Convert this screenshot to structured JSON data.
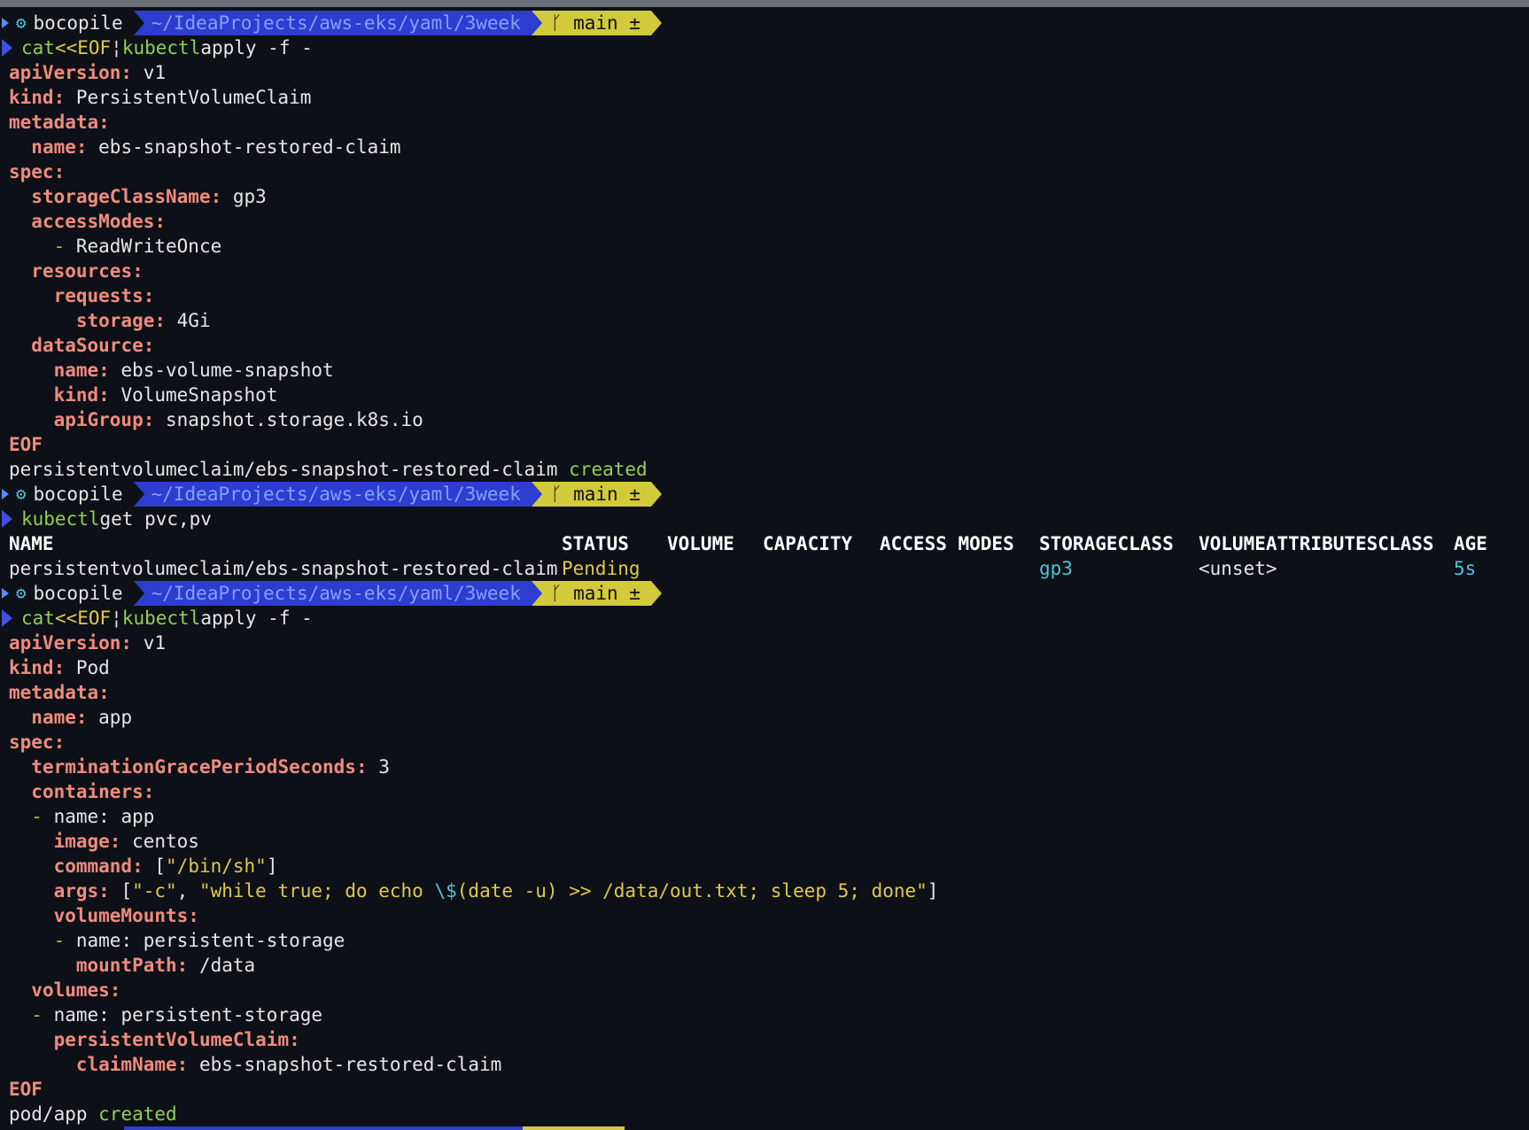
{
  "prompt": {
    "user": "bocopile",
    "path": "~/IdeaProjects/aws-eks/yaml/3week",
    "branch": "main ±"
  },
  "cmd1": {
    "a": "cat",
    "b": "<<EOF",
    "pipe": "¦",
    "c": "kubectl",
    "d": "apply -f -"
  },
  "yaml1": [
    {
      "indent": "",
      "key": "apiVersion:",
      "val": " v1"
    },
    {
      "indent": "",
      "key": "kind:",
      "val": " PersistentVolumeClaim"
    },
    {
      "indent": "",
      "key": "metadata:",
      "val": ""
    },
    {
      "indent": "  ",
      "key": "name:",
      "val": " ebs-snapshot-restored-claim"
    },
    {
      "indent": "",
      "key": "spec:",
      "val": ""
    },
    {
      "indent": "  ",
      "key": "storageClassName:",
      "val": " gp3"
    },
    {
      "indent": "  ",
      "key": "accessModes:",
      "val": ""
    },
    {
      "indent": "    ",
      "dash": "- ",
      "key": "",
      "val": "ReadWriteOnce"
    },
    {
      "indent": "  ",
      "key": "resources:",
      "val": ""
    },
    {
      "indent": "    ",
      "key": "requests:",
      "val": ""
    },
    {
      "indent": "      ",
      "key": "storage:",
      "val": " 4Gi"
    },
    {
      "indent": "  ",
      "key": "dataSource:",
      "val": ""
    },
    {
      "indent": "    ",
      "key": "name:",
      "val": " ebs-volume-snapshot"
    },
    {
      "indent": "    ",
      "key": "kind:",
      "val": " VolumeSnapshot"
    },
    {
      "indent": "    ",
      "key": "apiGroup:",
      "val": " snapshot.storage.k8s.io"
    },
    {
      "indent": "",
      "key": "EOF",
      "val": ""
    }
  ],
  "result1": {
    "text": "persistentvolumeclaim/ebs-snapshot-restored-claim ",
    "status": "created"
  },
  "cmd2": {
    "a": "kubectl",
    "b": "get pvc,pv"
  },
  "table": {
    "headers": [
      "NAME",
      "STATUS",
      "VOLUME",
      "CAPACITY",
      "ACCESS MODES",
      "STORAGECLASS",
      "VOLUMEATTRIBUTESCLASS",
      "AGE"
    ],
    "row": {
      "name": "persistentvolumeclaim/ebs-snapshot-restored-claim",
      "status": "Pending",
      "storageclass": "gp3",
      "vac": "<unset>",
      "age": "5s"
    }
  },
  "cmd3": {
    "a": "cat",
    "b": "<<EOF",
    "pipe": "¦",
    "c": "kubectl",
    "d": "apply -f -"
  },
  "yaml2": {
    "l1k": "apiVersion:",
    "l1v": " v1",
    "l2k": "kind:",
    "l2v": " Pod",
    "l3k": "metadata:",
    "l4k": "name:",
    "l4v": " app",
    "l5k": "spec:",
    "l6k": "terminationGracePeriodSeconds:",
    "l6v": " 3",
    "l7k": "containers:",
    "l8v": "name: app",
    "l9k": "image:",
    "l9v": " centos",
    "l10k": "command:",
    "l10a": " [",
    "l10s": "\"/bin/sh\"",
    "l10b": "]",
    "l11k": "args:",
    "l11a": " [",
    "l11s1": "\"-c\"",
    "l11c": ", ",
    "l11s2": "\"while true; do echo ",
    "l11esc": "\\$",
    "l11s3": "(date -u) >> /data/out.txt; sleep 5; done\"",
    "l11b": "]",
    "l12k": "volumeMounts:",
    "l13v": "name: persistent-storage",
    "l14k": "mountPath:",
    "l14v": " /data",
    "l15k": "volumes:",
    "l16v": "name: persistent-storage",
    "l17k": "persistentVolumeClaim:",
    "l18k": "claimName:",
    "l18v": " ebs-snapshot-restored-claim",
    "l19k": "EOF"
  },
  "result2": {
    "text": "pod/app ",
    "status": "created"
  }
}
